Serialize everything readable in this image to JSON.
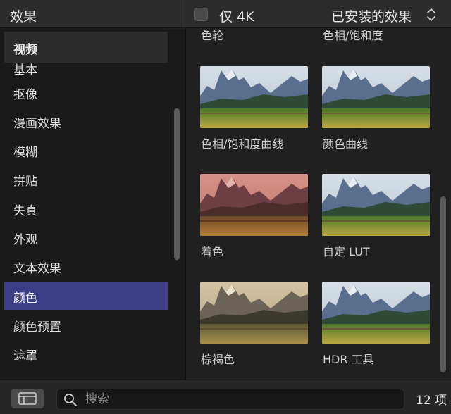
{
  "header": {
    "title": "效果",
    "filter_checkbox_checked": false,
    "filter_label": "仅 4K",
    "collection_popup": "已安装的效果"
  },
  "sidebar": {
    "section_header": "视频",
    "items": [
      {
        "label": "基本",
        "selected": false
      },
      {
        "label": "抠像",
        "selected": false
      },
      {
        "label": "漫画效果",
        "selected": false
      },
      {
        "label": "模糊",
        "selected": false
      },
      {
        "label": "拼贴",
        "selected": false
      },
      {
        "label": "失真",
        "selected": false
      },
      {
        "label": "外观",
        "selected": false
      },
      {
        "label": "文本效果",
        "selected": false
      },
      {
        "label": "颜色",
        "selected": true
      },
      {
        "label": "颜色预置",
        "selected": false
      },
      {
        "label": "遮罩",
        "selected": false
      }
    ]
  },
  "browser": {
    "partial_row": [
      "色轮",
      "色相/饱和度"
    ],
    "effects": [
      {
        "label": "色相/饱和度曲线",
        "tint": "normal"
      },
      {
        "label": "颜色曲线",
        "tint": "normal"
      },
      {
        "label": "着色",
        "tint": "red-tinted"
      },
      {
        "label": "自定 LUT",
        "tint": "normal"
      },
      {
        "label": "棕褐色",
        "tint": "sepia"
      },
      {
        "label": "HDR 工具",
        "tint": "normal"
      }
    ]
  },
  "footer": {
    "search_placeholder": "搜索",
    "search_value": "",
    "item_count": "12 项"
  },
  "colors": {
    "selection": "#3c3f86",
    "panel_background": "#202020",
    "sidebar_background": "#1a1a1a"
  }
}
